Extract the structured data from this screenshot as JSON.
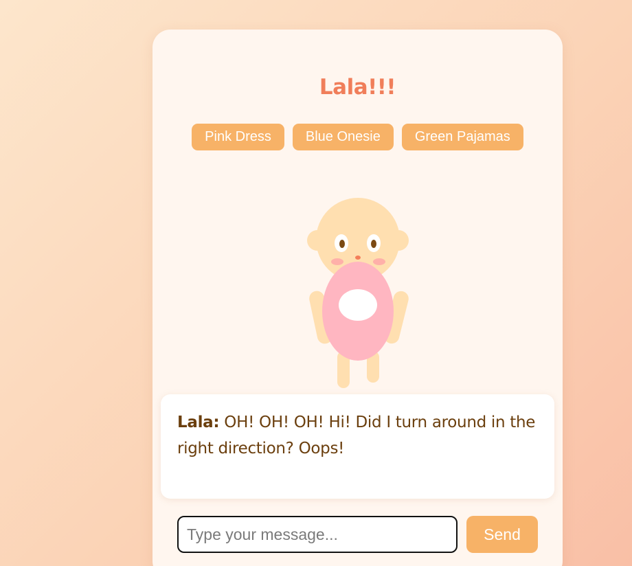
{
  "title": "Lala!!!",
  "outfits": [
    {
      "label": "Pink Dress"
    },
    {
      "label": "Blue Onesie"
    },
    {
      "label": "Green Pajamas"
    }
  ],
  "dialog": {
    "speaker": "Lala:",
    "message": "OH! OH! OH! Hi! Did I turn around in the right direction? Oops!"
  },
  "input": {
    "placeholder": "Type your message...",
    "value": ""
  },
  "send_label": "Send",
  "colors": {
    "accent": "#f7b267",
    "title": "#f07e5a",
    "dialog_text": "#6b3f0e",
    "card_bg": "#fff6ef",
    "dress": "#ffb6c1",
    "skin": "#ffdfb0"
  },
  "character": {
    "outfit": "Pink Dress",
    "icon": "baby-character-icon"
  }
}
